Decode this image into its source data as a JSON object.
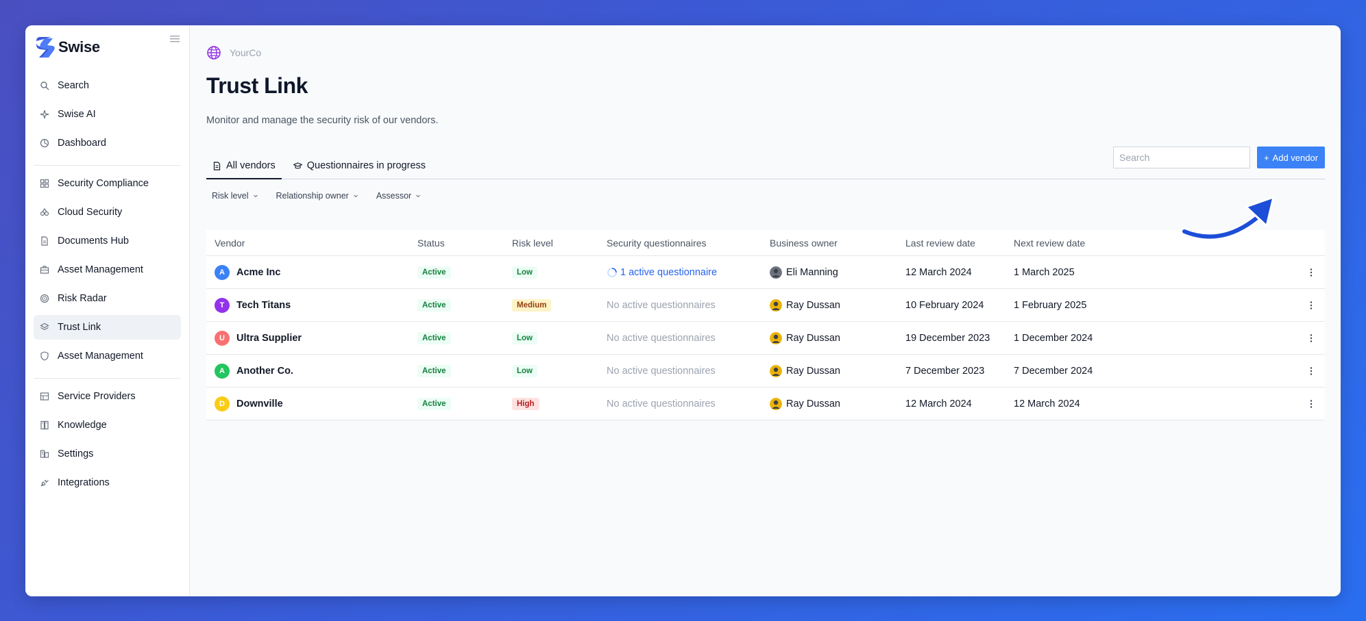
{
  "brand": {
    "name": "Swise",
    "accent": "#3b82f6"
  },
  "sidebar": {
    "groups": [
      [
        {
          "label": "Search",
          "icon": "search-icon"
        },
        {
          "label": "Swise AI",
          "icon": "sparkle-icon"
        },
        {
          "label": "Dashboard",
          "icon": "dashboard-icon"
        }
      ],
      [
        {
          "label": "Security Compliance",
          "icon": "compliance-icon"
        },
        {
          "label": "Cloud Security",
          "icon": "cloud-icon"
        },
        {
          "label": "Documents Hub",
          "icon": "document-icon"
        },
        {
          "label": "Asset Management",
          "icon": "briefcase-icon"
        },
        {
          "label": "Risk Radar",
          "icon": "radar-icon"
        },
        {
          "label": "Trust Link",
          "icon": "layers-icon",
          "active": true
        },
        {
          "label": "Asset Management",
          "icon": "shield-icon"
        }
      ],
      [
        {
          "label": "Service Providers",
          "icon": "providers-icon"
        },
        {
          "label": "Knowledge",
          "icon": "book-icon"
        },
        {
          "label": "Settings",
          "icon": "settings-icon"
        },
        {
          "label": "Integrations",
          "icon": "plug-icon"
        }
      ]
    ]
  },
  "header": {
    "org": "YourCo",
    "title": "Trust Link",
    "subtitle": "Monitor and manage the security risk of our vendors."
  },
  "tabs": [
    {
      "label": "All vendors",
      "icon": "document-icon",
      "active": true
    },
    {
      "label": "Questionnaires in progress",
      "icon": "graduation-cap-icon",
      "active": false
    }
  ],
  "search": {
    "placeholder": "Search"
  },
  "add_button": {
    "label": "Add vendor",
    "prefix": "+"
  },
  "filters": [
    "Risk level",
    "Relationship owner",
    "Assessor"
  ],
  "table": {
    "columns": [
      "Vendor",
      "Status",
      "Risk level",
      "Security questionnaires",
      "Business owner",
      "Last review date",
      "Next review date"
    ],
    "rows": [
      {
        "initial": "A",
        "avatar_color": "#3b82f6",
        "vendor": "Acme Inc",
        "status": "Active",
        "risk": "Low",
        "risk_level": "low",
        "questionnaire": "1 active questionnaire",
        "questionnaire_active": true,
        "owner": "Eli Manning",
        "owner_color": "#6b7280",
        "last_review": "12 March 2024",
        "next_review": "1 March 2025"
      },
      {
        "initial": "T",
        "avatar_color": "#9333ea",
        "vendor": "Tech Titans",
        "status": "Active",
        "risk": "Medium",
        "risk_level": "medium",
        "questionnaire": "No active questionnaires",
        "questionnaire_active": false,
        "owner": "Ray Dussan",
        "owner_color": "#eab308",
        "last_review": "10 February 2024",
        "next_review": "1 February 2025"
      },
      {
        "initial": "U",
        "avatar_color": "#f87171",
        "vendor": "Ultra Supplier",
        "status": "Active",
        "risk": "Low",
        "risk_level": "low",
        "questionnaire": "No active questionnaires",
        "questionnaire_active": false,
        "owner": "Ray Dussan",
        "owner_color": "#eab308",
        "last_review": "19 December 2023",
        "next_review": "1 December 2024"
      },
      {
        "initial": "A",
        "avatar_color": "#22c55e",
        "vendor": "Another Co.",
        "status": "Active",
        "risk": "Low",
        "risk_level": "low",
        "questionnaire": "No active questionnaires",
        "questionnaire_active": false,
        "owner": "Ray Dussan",
        "owner_color": "#eab308",
        "last_review": "7 December 2023",
        "next_review": "7 December 2024"
      },
      {
        "initial": "D",
        "avatar_color": "#facc15",
        "vendor": "Downville",
        "status": "Active",
        "risk": "High",
        "risk_level": "high",
        "questionnaire": "No active questionnaires",
        "questionnaire_active": false,
        "owner": "Ray Dussan",
        "owner_color": "#eab308",
        "last_review": "12 March 2024",
        "next_review": "12 March 2024"
      }
    ]
  }
}
